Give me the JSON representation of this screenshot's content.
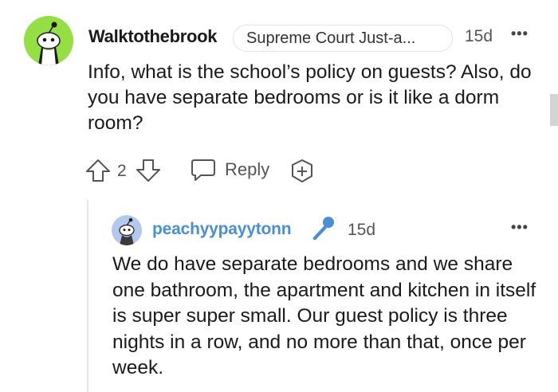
{
  "comment": {
    "author": "Walktothebrook",
    "flair": "Supreme Court Just-a...",
    "time": "15d",
    "more": "•••",
    "body": "Info, what is the school’s policy on guests? Also, do you have separate bedrooms or is it like a dorm room?",
    "score": "2",
    "reply_label": "Reply",
    "avatar_color": "#94e044"
  },
  "reply": {
    "author": "peachyypayytonn",
    "time": "15d",
    "more": "•••",
    "body": "We do have separate bedrooms and we share one bathroom, the apartment and kitchen in itself is super super small. Our guest policy is three nights in a row, and no more than that, once per week.",
    "author_color": "#4a8fd6",
    "avatar_color": "#b4c8ee"
  },
  "icons": [
    "upvote-icon",
    "downvote-icon",
    "reply-icon",
    "award-icon",
    "microphone-icon",
    "more-options-icon"
  ]
}
